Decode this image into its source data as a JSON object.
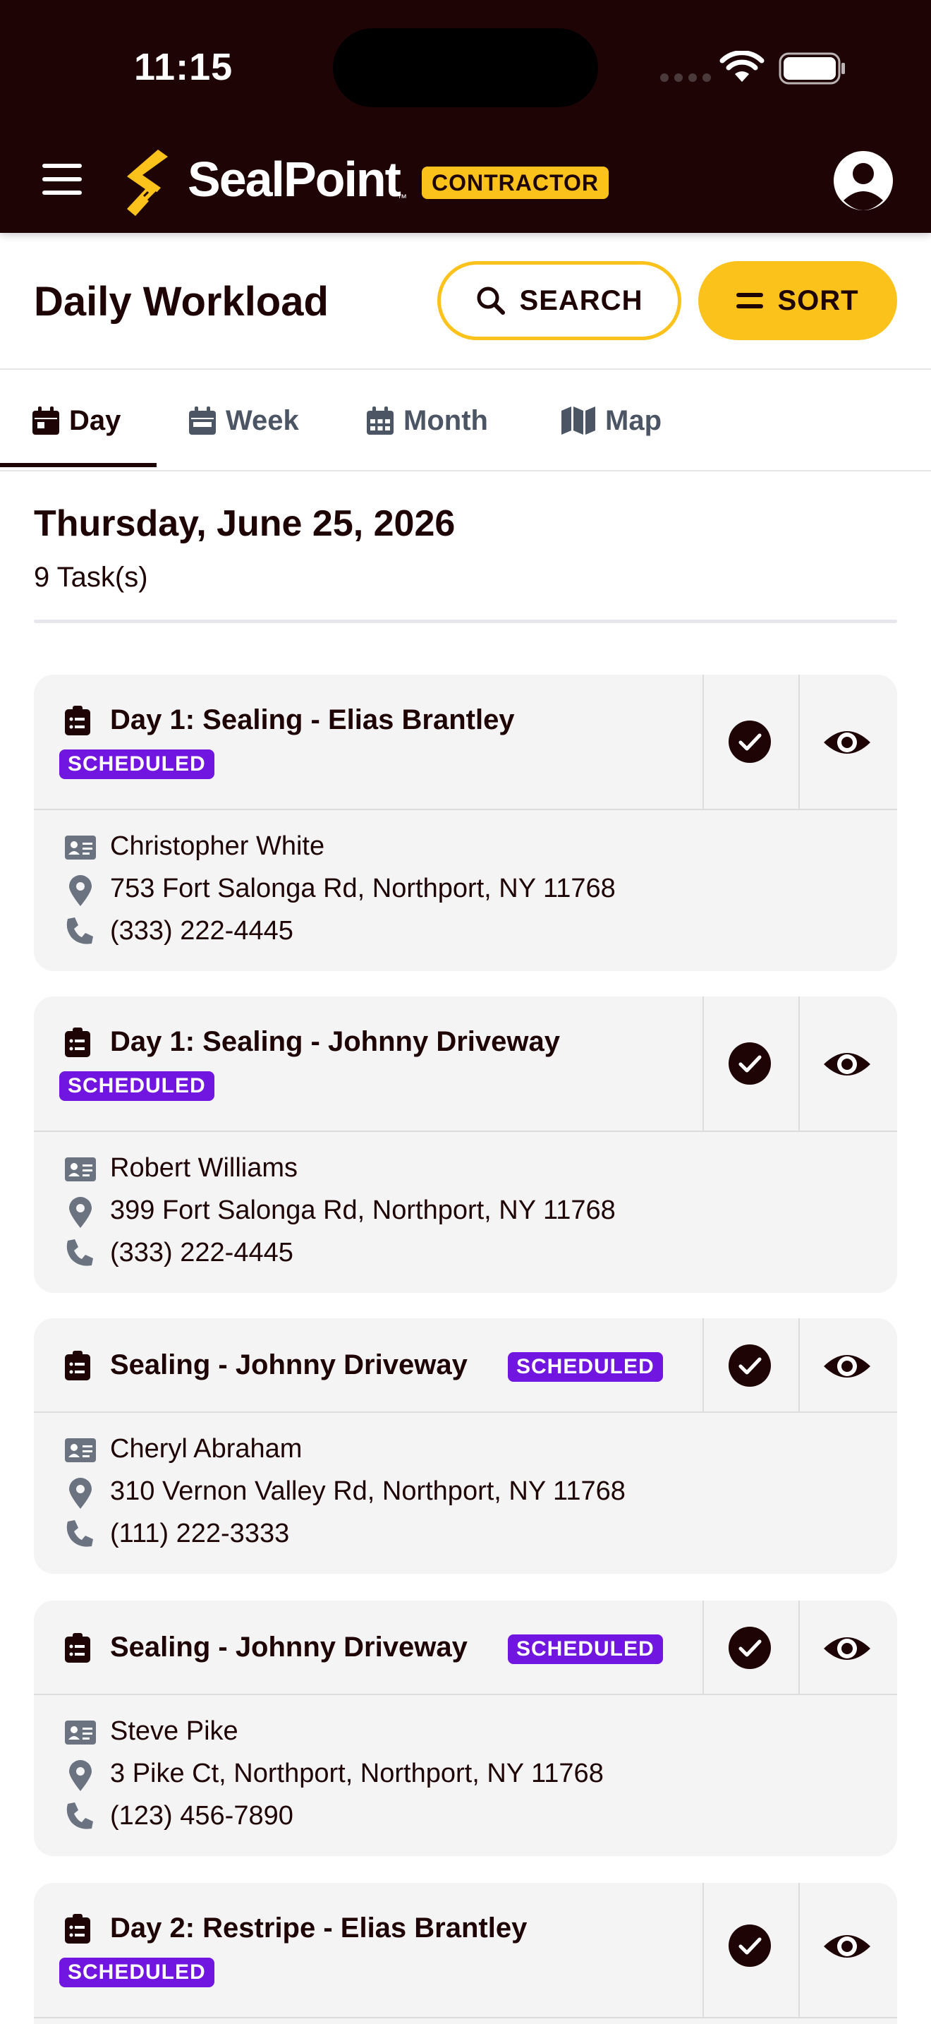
{
  "status_bar": {
    "time": "11:15"
  },
  "app": {
    "brand": "SealPoint",
    "trademark": "™",
    "role_badge": "CONTRACTOR",
    "colors": {
      "bar": "#1f0406",
      "accent": "#fbc21c",
      "badge": "#7016e0"
    }
  },
  "header": {
    "title": "Daily Workload",
    "search_label": "SEARCH",
    "sort_label": "SORT"
  },
  "tabs": [
    {
      "label": "Day",
      "icon": "calendar-day-icon",
      "active": true
    },
    {
      "label": "Week",
      "icon": "calendar-week-icon",
      "active": false
    },
    {
      "label": "Month",
      "icon": "calendar-month-icon",
      "active": false
    },
    {
      "label": "Map",
      "icon": "map-icon",
      "active": false
    }
  ],
  "day": {
    "date": "Thursday, June 25, 2026",
    "count": "9 Task(s)"
  },
  "tasks": [
    {
      "title": "Day 1: Sealing - Elias Brantley",
      "status": "SCHEDULED",
      "customer": "Christopher White",
      "address": "753 Fort Salonga Rd, Northport, NY 11768",
      "phone": "(333) 222-4445"
    },
    {
      "title": "Day 1: Sealing - Johnny Driveway",
      "status": "SCHEDULED",
      "customer": "Robert Williams",
      "address": "399 Fort Salonga Rd, Northport, NY 11768",
      "phone": "(333) 222-4445"
    },
    {
      "title": "Sealing - Johnny Driveway",
      "status": "SCHEDULED",
      "customer": "Cheryl Abraham",
      "address": "310 Vernon Valley Rd, Northport, NY 11768",
      "phone": "(111) 222-3333"
    },
    {
      "title": "Sealing - Johnny Driveway",
      "status": "SCHEDULED",
      "customer": "Steve Pike",
      "address": "3 Pike Ct, Northport, Northport, NY 11768",
      "phone": "(123) 456-7890"
    },
    {
      "title": "Day 2: Restripe - Elias Brantley",
      "status": "SCHEDULED"
    }
  ]
}
